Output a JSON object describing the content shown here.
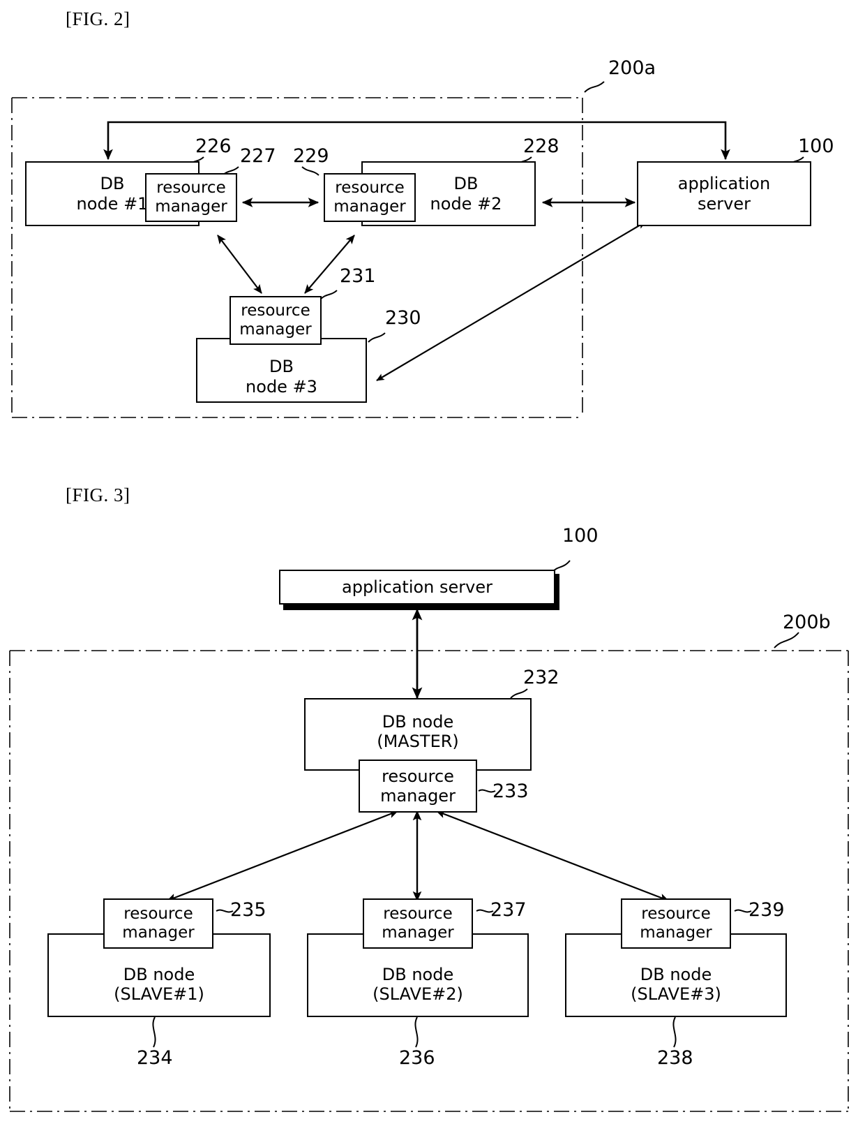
{
  "figures": [
    {
      "label": "[FIG. 2]",
      "boundary_ref": "200a",
      "boxes": [
        {
          "id": "db1",
          "lines": [
            "DB",
            "node #1"
          ],
          "ref": "226"
        },
        {
          "id": "rm1",
          "lines": [
            "resource",
            "manager"
          ],
          "ref": "227"
        },
        {
          "id": "rm2",
          "lines": [
            "resource",
            "manager"
          ],
          "ref": "229"
        },
        {
          "id": "db2",
          "lines": [
            "DB",
            "node #2"
          ],
          "ref": "228"
        },
        {
          "id": "rm3",
          "lines": [
            "resource",
            "manager"
          ],
          "ref": "231"
        },
        {
          "id": "db3",
          "lines": [
            "DB",
            "node #3"
          ],
          "ref": "230"
        },
        {
          "id": "app1",
          "lines": [
            "application",
            "server"
          ],
          "ref": "100"
        }
      ]
    },
    {
      "label": "[FIG. 3]",
      "boundary_ref": "200b",
      "boxes": [
        {
          "id": "app2",
          "lines": [
            "application server"
          ],
          "ref": "100"
        },
        {
          "id": "master",
          "lines": [
            "DB node",
            "(MASTER)"
          ],
          "ref": "232"
        },
        {
          "id": "rmM",
          "lines": [
            "resource",
            "manager"
          ],
          "ref": "233"
        },
        {
          "id": "rmS1",
          "lines": [
            "resource",
            "manager"
          ],
          "ref": "235"
        },
        {
          "id": "slave1",
          "lines": [
            "DB node",
            "(SLAVE#1)"
          ],
          "ref": "234"
        },
        {
          "id": "rmS2",
          "lines": [
            "resource",
            "manager"
          ],
          "ref": "237"
        },
        {
          "id": "slave2",
          "lines": [
            "DB node",
            "(SLAVE#2)"
          ],
          "ref": "236"
        },
        {
          "id": "rmS3",
          "lines": [
            "resource",
            "manager"
          ],
          "ref": "239"
        },
        {
          "id": "slave3",
          "lines": [
            "DB node",
            "(SLAVE#3)"
          ],
          "ref": "238"
        }
      ]
    }
  ],
  "fig2": {
    "label": "[FIG. 2]",
    "boundary_ref": "200a",
    "db1_l1": "DB",
    "db1_l2": "node #1",
    "db1_ref": "226",
    "rm1_l1": "resource",
    "rm1_l2": "manager",
    "rm1_ref": "227",
    "rm2_l1": "resource",
    "rm2_l2": "manager",
    "rm2_ref": "229",
    "db2_l1": "DB",
    "db2_l2": "node #2",
    "db2_ref": "228",
    "rm3_l1": "resource",
    "rm3_l2": "manager",
    "rm3_ref": "231",
    "db3_l1": "DB",
    "db3_l2": "node #3",
    "db3_ref": "230",
    "app_l1": "application",
    "app_l2": "server",
    "app_ref": "100"
  },
  "fig3": {
    "label": "[FIG. 3]",
    "boundary_ref": "200b",
    "app_l1": "application server",
    "app_ref": "100",
    "master_l1": "DB node",
    "master_l2": "(MASTER)",
    "master_ref": "232",
    "rmM_l1": "resource",
    "rmM_l2": "manager",
    "rmM_ref": "233",
    "rmS1_l1": "resource",
    "rmS1_l2": "manager",
    "rmS1_ref": "235",
    "slave1_l1": "DB node",
    "slave1_l2": "(SLAVE#1)",
    "slave1_ref": "234",
    "rmS2_l1": "resource",
    "rmS2_l2": "manager",
    "rmS2_ref": "237",
    "slave2_l1": "DB node",
    "slave2_l2": "(SLAVE#2)",
    "slave2_ref": "236",
    "rmS3_l1": "resource",
    "rmS3_l2": "manager",
    "rmS3_ref": "239",
    "slave3_l1": "DB node",
    "slave3_l2": "(SLAVE#3)",
    "slave3_ref": "238"
  },
  "colors": {
    "ink": "#000000",
    "paper": "#ffffff"
  }
}
